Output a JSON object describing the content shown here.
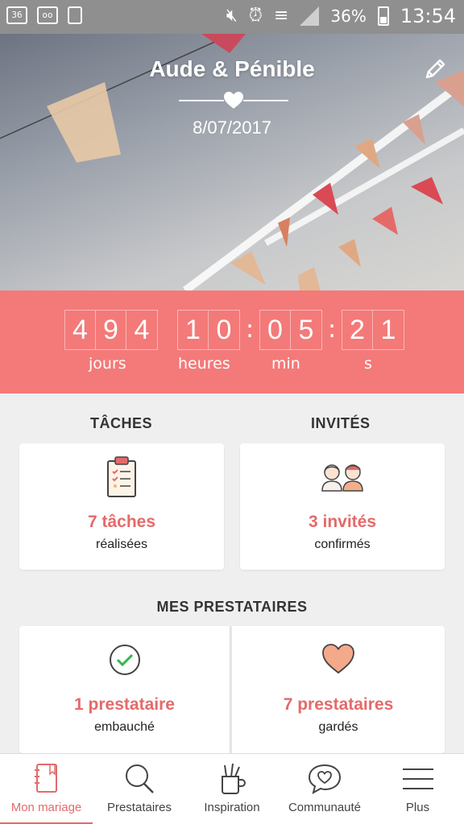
{
  "status_bar": {
    "left_icons": [
      "36-icon",
      "voicemail-icon",
      "sim-icon"
    ],
    "battery": "36%",
    "time": "13:54",
    "right_icons": [
      "mute-icon",
      "alarm-icon",
      "wifi-icon",
      "signal-icon",
      "battery-icon"
    ]
  },
  "header": {
    "couple": "Aude & Pénible",
    "date": "8/07/2017"
  },
  "countdown": {
    "days_digits": [
      "4",
      "9",
      "4"
    ],
    "hours_digits": [
      "1",
      "0"
    ],
    "minutes_digits": [
      "0",
      "5"
    ],
    "seconds_digits": [
      "2",
      "1"
    ],
    "separator": ":",
    "labels": {
      "days": "jours",
      "hours": "heures",
      "minutes": "min",
      "seconds": "s"
    }
  },
  "tasks": {
    "title": "TÂCHES",
    "value": "7 tâches",
    "sub": "réalisées"
  },
  "guests": {
    "title": "INVITÉS",
    "value": "3 invités",
    "sub": "confirmés"
  },
  "vendors": {
    "title": "MES PRESTATAIRES",
    "hired": {
      "value": "1 prestataire",
      "sub": "embauché"
    },
    "saved": {
      "value": "7 prestataires",
      "sub": "gardés"
    }
  },
  "nav": {
    "items": [
      {
        "label": "Mon mariage",
        "icon": "notebook-icon",
        "active": true
      },
      {
        "label": "Prestataires",
        "icon": "search-icon",
        "active": false
      },
      {
        "label": "Inspiration",
        "icon": "pencil-cup-icon",
        "active": false
      },
      {
        "label": "Communauté",
        "icon": "chat-heart-icon",
        "active": false
      },
      {
        "label": "Plus",
        "icon": "menu-icon",
        "active": false
      }
    ]
  },
  "colors": {
    "accent": "#f37a79",
    "accent_text": "#e46a6a",
    "background": "#efefef"
  }
}
